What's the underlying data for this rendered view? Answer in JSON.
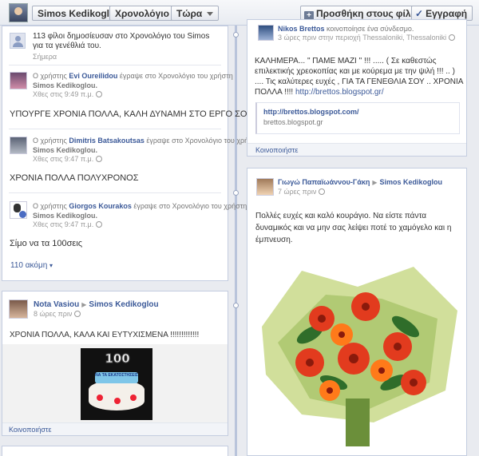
{
  "topbar": {
    "profile_name": "Simos Kedikoglou",
    "timeline_label": "Χρονολόγιο",
    "now_label": "Τώρα",
    "add_friend_label": "Προσθήκη στους φίλους",
    "subscribe_label": "Εγγραφή"
  },
  "left": {
    "summary": {
      "text": "113 φίλοι δημοσίευσαν στο Χρονολόγιο του Simos για τα γενέθλιά του.",
      "time": "Σήμερα"
    },
    "items": [
      {
        "prefix": "Ο χρήστης",
        "author": "Evi Oureilidou",
        "mid": "έγραψε στο Χρονολόγιο του χρήστη",
        "target": "Simos Kedikoglou.",
        "time": "Χθες στις 9:49 π.μ.",
        "message": "ΥΠΟΥΡΓΕ ΧΡΟΝΙΑ ΠΟΛΛΑ, ΚΑΛΗ ΔΥΝΑΜΗ ΣΤΟ ΕΡΓΟ ΣΟΥ!!!"
      },
      {
        "prefix": "Ο χρήστης",
        "author": "Dimitris Batsakoutsas",
        "mid": "έγραψε στο Χρονολόγιο του χρήστη",
        "target": "Simos Kedikoglou.",
        "time": "Χθες στις 9:47 π.μ.",
        "message": "ΧΡΟΝΙΑ ΠΟΛΛΑ ΠΟΛΥΧΡΟΝΟΣ"
      },
      {
        "prefix": "Ο χρήστης",
        "author": "Giorgos Kourakos",
        "mid": "έγραψε στο Χρονολόγιο του χρήστη",
        "target": "Simos Kedikoglou.",
        "time": "Χθες στις 9:47 π.μ.",
        "message": "Σίμο να τα 100σεις"
      }
    ],
    "more": "110 ακόμη"
  },
  "left2": {
    "author": "Nota Vasiou",
    "target": "Simos Kedikoglou",
    "time": "8 ώρες πριν",
    "message": "ΧΡΟΝΙΑ ΠΟΛΛΑ, ΚΑΛΑ ΚΑΙ ΕΥΤΥΧΙΣΜΕΝΑ !!!!!!!!!!!!!",
    "cake_number": "100",
    "cake_text": "ΝΑ ΤΑ ΕΚΑΤΟΣΤΗΣΕΙΣ",
    "share": "Κοινοποιήστε"
  },
  "right1": {
    "author": "Nikos Brettos",
    "action": "κοινοποίησε ένα σύνδεσμο.",
    "time": "3 ώρες πριν στην περιοχή Thessaloniki, Thessaloniki",
    "message": "ΚΑΛΗΜΕΡΑ... \" ΠΑΜΕ ΜΑΖΙ \" !!! ..... ( Σε καθεστώς επιλεκτικής χρεοκοπίας και με κούρεμα με την ψιλή !!! .. ) .... Τις καλύτερες ευχές , ΓΙΑ ΤΑ ΓΕΝΕΘΛΙΑ ΣΟΥ .. ΧΡΟΝΙΑ ΠΟΛΛΑ !!!!",
    "message_link": "http://brettos.blogspot.gr/",
    "card_url": "http://brettos.blogspot.com/",
    "card_domain": "brettos.blogspot.gr",
    "share": "Κοινοποιήστε"
  },
  "right2": {
    "author": "Γιωγώ Παπαϊωάννου-Γάκη",
    "target": "Simos Kedikoglou",
    "time": "7 ώρες πριν",
    "message": "Πολλές ευχές και καλό κουράγιο. Να είστε πάντα δυναμικός και να μην σας λείψει ποτέ το χαμόγελο και η έμπνευση."
  },
  "colors": {
    "link": "#3b5998",
    "timeline": "#b9c4db"
  }
}
